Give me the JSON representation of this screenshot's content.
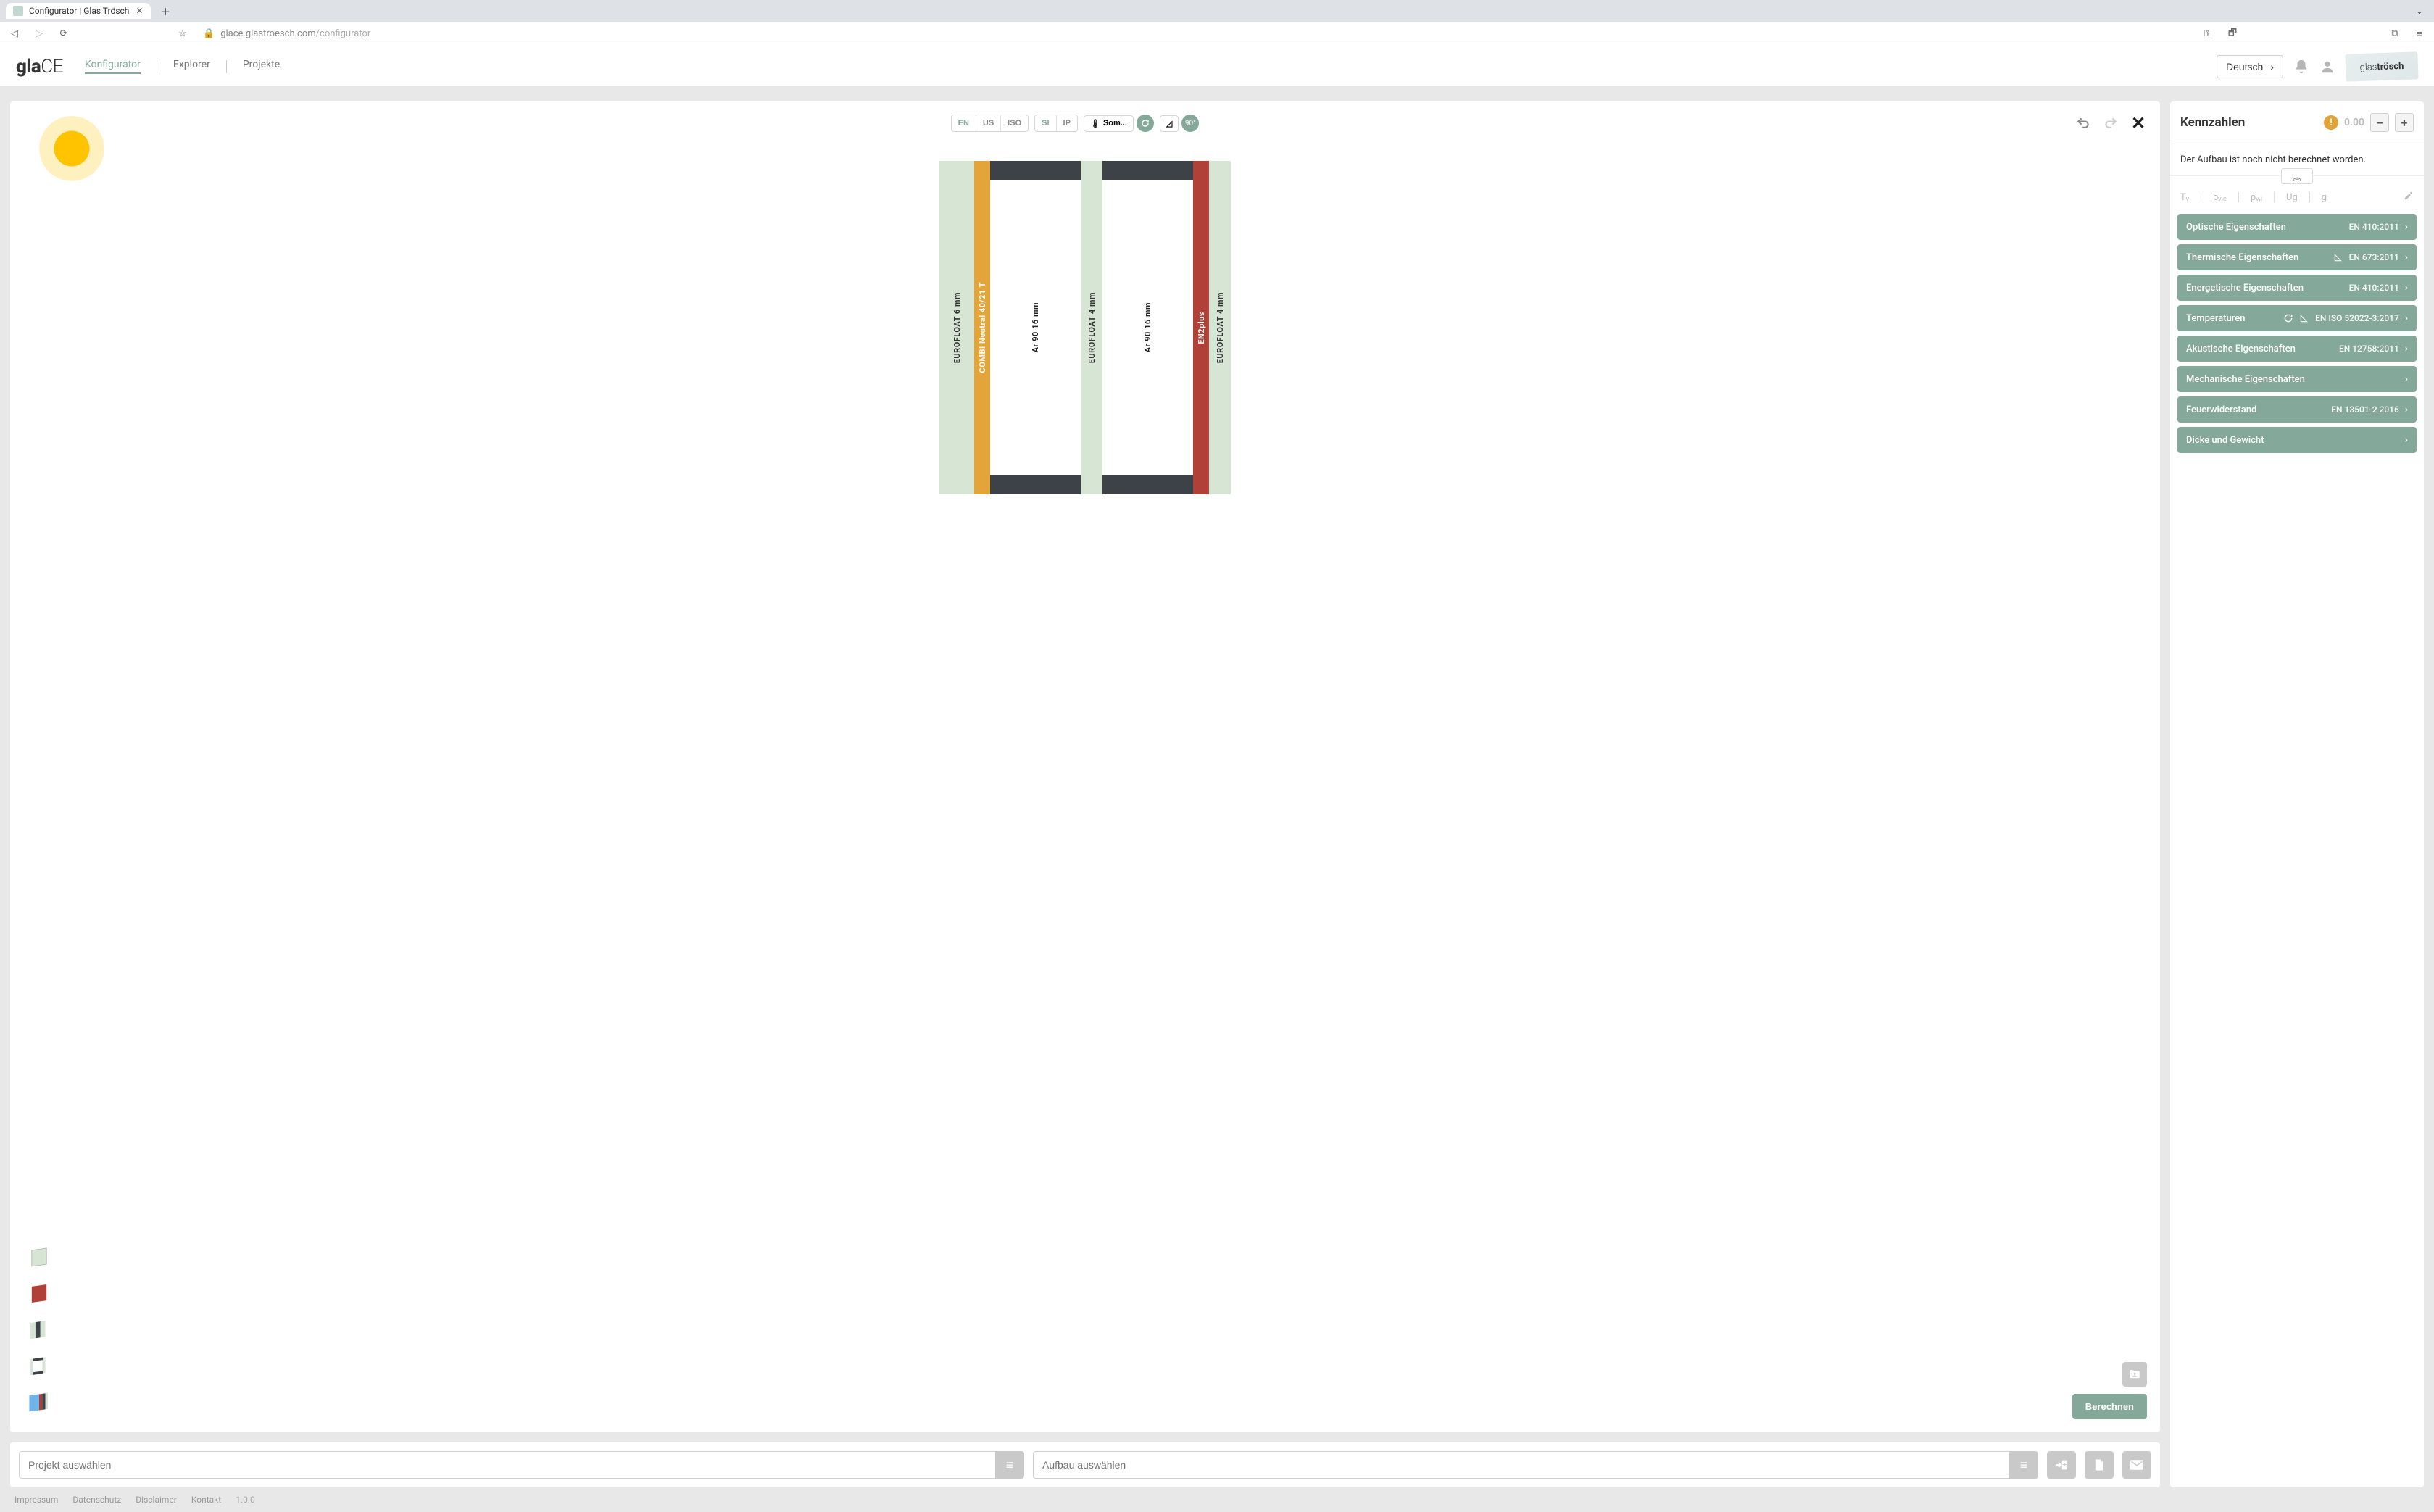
{
  "browser": {
    "tab_title": "Configurator | Glas Trösch",
    "url_host": "glace.glastroesch.com",
    "url_path": "/configurator"
  },
  "header": {
    "logo_light": "gla",
    "logo_bold": "CE",
    "nav": {
      "konfigurator": "Konfigurator",
      "explorer": "Explorer",
      "projekte": "Projekte"
    },
    "lang": "Deutsch",
    "brand_light": "glas",
    "brand_bold": "trösch"
  },
  "canvas": {
    "standards": {
      "en": "EN",
      "us": "US",
      "iso": "ISO"
    },
    "units": {
      "si": "SI",
      "ip": "IP"
    },
    "climate_label": "Som...",
    "angle_label": "90°",
    "calc_button": "Berechnen",
    "layers": {
      "glass1": "EUROFLOAT   6 mm",
      "coating1": "COMBI Neutral 40/21 T",
      "spacer1": "Ar 90   16 mm",
      "glass2": "EUROFLOAT   4 mm",
      "spacer2": "Ar 90   16 mm",
      "coating2": "EN2plus",
      "glass3": "EUROFLOAT   4 mm"
    }
  },
  "selectors": {
    "project_placeholder": "Projekt auswählen",
    "build_placeholder": "Aufbau auswählen"
  },
  "panel": {
    "title": "Kennzahlen",
    "value": "0.00",
    "notice": "Der Aufbau ist noch nicht berechnet worden.",
    "symbols": {
      "tv": "Tᵥ",
      "pve": "ρᵥ,ₑ",
      "pvi": "ρᵥ,ᵢ",
      "ug": "Ug",
      "g": "g"
    },
    "accordions": [
      {
        "label": "Optische Eigenschaften",
        "norm": "EN 410:2011",
        "icons": ""
      },
      {
        "label": "Thermische Eigenschaften",
        "norm": "EN 673:2011",
        "icons": "angle"
      },
      {
        "label": "Energetische Eigenschaften",
        "norm": "EN 410:2011",
        "icons": ""
      },
      {
        "label": "Temperaturen",
        "norm": "EN ISO 52022-3:2017",
        "icons": "refresh angle"
      },
      {
        "label": "Akustische Eigenschaften",
        "norm": "EN 12758:2011",
        "icons": ""
      },
      {
        "label": "Mechanische Eigenschaften",
        "norm": "",
        "icons": ""
      },
      {
        "label": "Feuerwiderstand",
        "norm": "EN 13501-2 2016",
        "icons": ""
      },
      {
        "label": "Dicke und Gewicht",
        "norm": "",
        "icons": ""
      }
    ]
  },
  "footer": {
    "impressum": "Impressum",
    "datenschutz": "Datenschutz",
    "disclaimer": "Disclaimer",
    "kontakt": "Kontakt",
    "version": "1.0.0"
  }
}
